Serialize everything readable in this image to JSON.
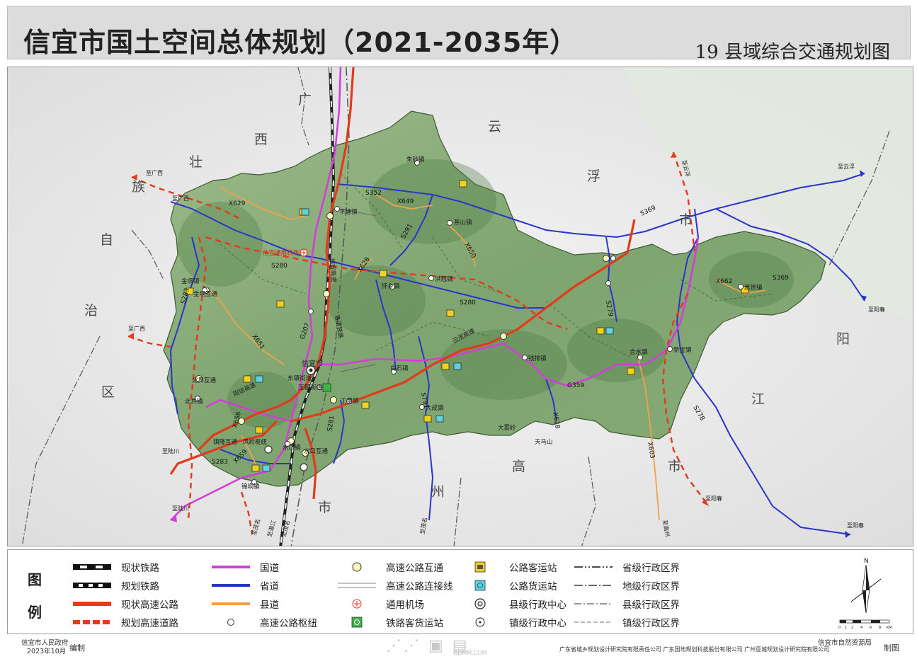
{
  "header": {
    "title": "信宜市国土空间总体规划（2021-2035年）",
    "subtitle": "19 县域综合交通规划图"
  },
  "map": {
    "region_labels": {
      "guangxi": [
        "广",
        "西",
        "壮",
        "族",
        "自",
        "治",
        "区"
      ],
      "yunfu": [
        "云",
        "浮",
        "市"
      ],
      "yangjiang": [
        "阳",
        "江",
        "市"
      ],
      "gaozhou": [
        "高",
        "州",
        "市"
      ]
    },
    "places": {
      "xinyi_city": "信宜市",
      "dongzhen": "东镇街道",
      "yudu": "玉都街道",
      "jinxiang": "金垌镇",
      "jinxiang_ic": "金垌互通",
      "beijie": "北界镇",
      "beijie_ic": "北界互通",
      "zhenlong_ic": "镇隆互通",
      "fengling": "风岭枢纽",
      "shuikou": "水口镇",
      "shuikou_ic": "水口互通",
      "xiangli": "锦垌镇",
      "pingtang": "平塘镇",
      "huaiying": "怀乡镇",
      "hongguan": "洪冠镇",
      "chashan": "茶山镇",
      "baishi": "白石镇",
      "qiantou": "钱排镇",
      "heshui": "合水镇",
      "xinbao": "新宝镇",
      "dacheng": "大成镇",
      "dingbao": "丁堡镇",
      "sihe": "思贺镇",
      "zhuwan": "朱砂镇",
      "dawu": "大雾岭",
      "tianma": "天马山",
      "airport": "信宜通用机场",
      "yunmao_hw": "云茂高速",
      "yangxin_hw": "阳信高速",
      "luoxin_rail": "洛湛铁路",
      "gaoxin_hw": "信宜高速"
    },
    "road_labels": {
      "s352": "S352",
      "s280a": "S280",
      "s280b": "S280",
      "s283a": "S283",
      "s283b": "S283",
      "s369a": "S369",
      "s369b": "S369",
      "s291": "S291",
      "s278": "S278",
      "s279": "S279",
      "s281": "S281",
      "s791": "S791",
      "g207": "G207",
      "g359": "G359",
      "x629": "X629",
      "x649": "X649",
      "x650": "X650",
      "x651": "X651",
      "x662": "X662",
      "x603": "X603",
      "x659": "X659",
      "x656": "X656",
      "x628": "X628",
      "x628b": "X628"
    },
    "destinations": {
      "to_yunfu": "至云浮",
      "to_guangxi1": "至广西",
      "to_guangxi2": "至广西",
      "to_guangxi3": "至广西",
      "to_luchuan": "至陆川",
      "to_luchuan2": "至陆川",
      "to_maoming": "至茂名",
      "to_maoming2": "至茂名",
      "to_maoming3": "至茂名",
      "to_yangchun": "至阳春",
      "to_yangchun2": "至阳春",
      "to_yangchun3": "至阳春",
      "to_yunfu2": "至云浮",
      "to_gaozhou": "至高州",
      "to_zhanjiang": "至湛江"
    }
  },
  "legend": {
    "head": [
      "图",
      "例"
    ],
    "items": [
      {
        "label": "现状铁路",
        "sym": "rail-existing"
      },
      {
        "label": "规划铁路",
        "sym": "rail-planned"
      },
      {
        "label": "现状高速公路",
        "sym": "hw-existing"
      },
      {
        "label": "规划高速道路",
        "sym": "hw-planned"
      },
      {
        "label": "国道",
        "sym": "national"
      },
      {
        "label": "省道",
        "sym": "provincial"
      },
      {
        "label": "县道",
        "sym": "county"
      },
      {
        "label": "高速公路枢纽",
        "sym": "hub"
      },
      {
        "label": "高速公路互通",
        "sym": "interchange"
      },
      {
        "label": "高速公路连接线",
        "sym": "connector"
      },
      {
        "label": "通用机场",
        "sym": "airport"
      },
      {
        "label": "铁路客货运站",
        "sym": "rail-station"
      },
      {
        "label": "公路客运站",
        "sym": "bus-station"
      },
      {
        "label": "公路货运站",
        "sym": "freight-station"
      },
      {
        "label": "县级行政中心",
        "sym": "county-center"
      },
      {
        "label": "镇级行政中心",
        "sym": "town-center"
      },
      {
        "label": "省级行政区界",
        "sym": "prov-border"
      },
      {
        "label": "地级行政区界",
        "sym": "pref-border"
      },
      {
        "label": "县级行政区界",
        "sym": "county-border"
      },
      {
        "label": "镇级行政区界",
        "sym": "town-border"
      }
    ]
  },
  "compass": {
    "north": "N",
    "scale_ticks": [
      "0",
      "1",
      "2",
      "4",
      "6",
      "8"
    ],
    "scale_unit": "KM"
  },
  "footer": {
    "left_org": "信宜市人民政府",
    "left_date": "2023年10月",
    "left_action": "编制",
    "right_org": "信宜市自然资源局",
    "right_companies": "广东省城乡规划设计研究院有限责任公司  广东国地规划科技股份有限公司  广州亚城规划设计研究院有限公司",
    "right_action": "制图",
    "watermark": "GDMM.COM"
  },
  "colors": {
    "highway": "#e8501f",
    "national": "#d23fd8",
    "provincial": "#2a3ad0",
    "county": "#f0a14a",
    "terrain": "#7aa06c",
    "background": "#e6e6e6"
  }
}
